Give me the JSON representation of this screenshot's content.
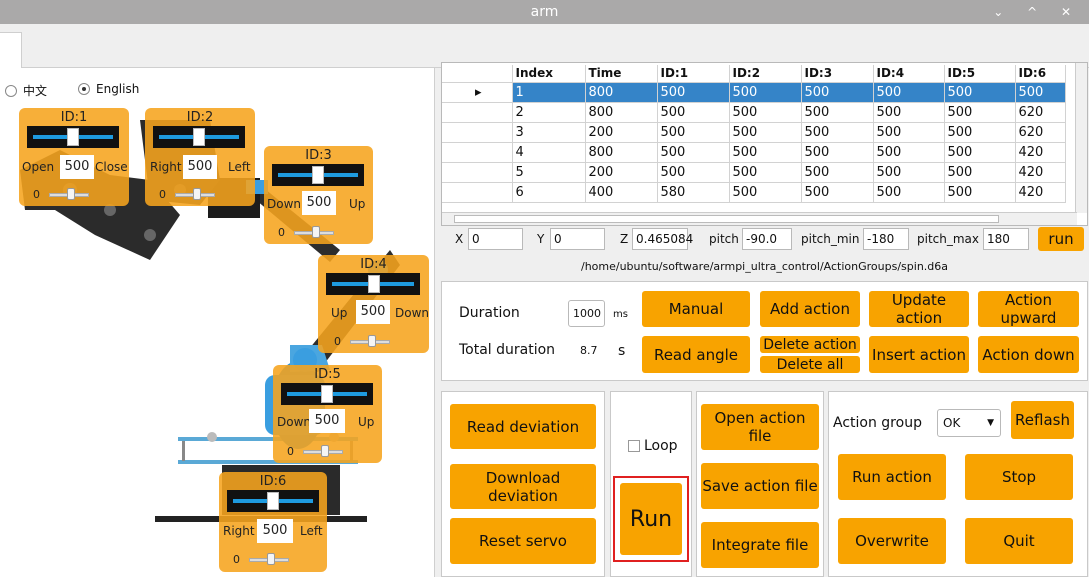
{
  "window": {
    "title": "arm",
    "controls": "⌄ ^ ✕"
  },
  "language": {
    "options": [
      "中文",
      "English"
    ],
    "selected": "English"
  },
  "servos": [
    {
      "id": "ID:1",
      "left_label": "Open",
      "right_label": "Close",
      "value": "500",
      "small": "0"
    },
    {
      "id": "ID:2",
      "left_label": "Right",
      "right_label": "Left",
      "value": "500",
      "small": "0"
    },
    {
      "id": "ID:3",
      "left_label": "Down",
      "right_label": "Up",
      "value": "500",
      "small": "0"
    },
    {
      "id": "ID:4",
      "left_label": "Up",
      "right_label": "Down",
      "value": "500",
      "small": "0"
    },
    {
      "id": "ID:5",
      "left_label": "Down",
      "right_label": "Up",
      "value": "500",
      "small": "0"
    },
    {
      "id": "ID:6",
      "left_label": "Right",
      "right_label": "Left",
      "value": "500",
      "small": "0"
    }
  ],
  "table": {
    "columns": [
      "Index",
      "Time",
      "ID:1",
      "ID:2",
      "ID:3",
      "ID:4",
      "ID:5",
      "ID:6"
    ],
    "rows": [
      [
        "1",
        "800",
        "500",
        "500",
        "500",
        "500",
        "500",
        "500"
      ],
      [
        "2",
        "800",
        "500",
        "500",
        "500",
        "500",
        "500",
        "620"
      ],
      [
        "3",
        "200",
        "500",
        "500",
        "500",
        "500",
        "500",
        "620"
      ],
      [
        "4",
        "800",
        "500",
        "500",
        "500",
        "500",
        "500",
        "420"
      ],
      [
        "5",
        "200",
        "500",
        "500",
        "500",
        "500",
        "500",
        "420"
      ],
      [
        "6",
        "400",
        "580",
        "500",
        "500",
        "500",
        "500",
        "420"
      ]
    ],
    "selected_row_marker": "▸"
  },
  "coords": {
    "x_label": "X",
    "x_value": "0",
    "y_label": "Y",
    "y_value": "0",
    "z_label": "Z",
    "z_value": "0.465084",
    "pitch_label": "pitch",
    "pitch_value": "-90.0",
    "pitch_min_label": "pitch_min",
    "pitch_min_value": "-180",
    "pitch_max_label": "pitch_max",
    "pitch_max_value": "180",
    "run_label": "run"
  },
  "path": "/home/ubuntu/software/armpi_ultra_control/ActionGroups/spin.d6a",
  "actions": {
    "duration_label": "Duration",
    "duration_value": "1000",
    "duration_unit": "ms",
    "total_label": "Total duration",
    "total_value": "8.7",
    "total_unit": "s",
    "manual": "Manual",
    "add_action": "Add action",
    "update_action": "Update action",
    "action_upward": "Action upward",
    "read_angle": "Read angle",
    "delete_action": "Delete action",
    "delete_all": "Delete all",
    "insert_action": "Insert action",
    "action_down": "Action down"
  },
  "bottom": {
    "read_deviation": "Read deviation",
    "download_deviation": "Download deviation",
    "reset_servo": "Reset servo",
    "loop": "Loop",
    "run": "Run",
    "open_action_file": "Open action file",
    "save_action_file": "Save action file",
    "integrate_file": "Integrate file",
    "action_group_label": "Action group",
    "action_group_value": "OK",
    "reflash": "Reflash",
    "run_action": "Run action",
    "stop": "Stop",
    "overwrite": "Overwrite",
    "quit": "Quit"
  },
  "colors": {
    "accent": "#f8a300",
    "selection": "#3584c8",
    "slider": "#1e9be0"
  }
}
